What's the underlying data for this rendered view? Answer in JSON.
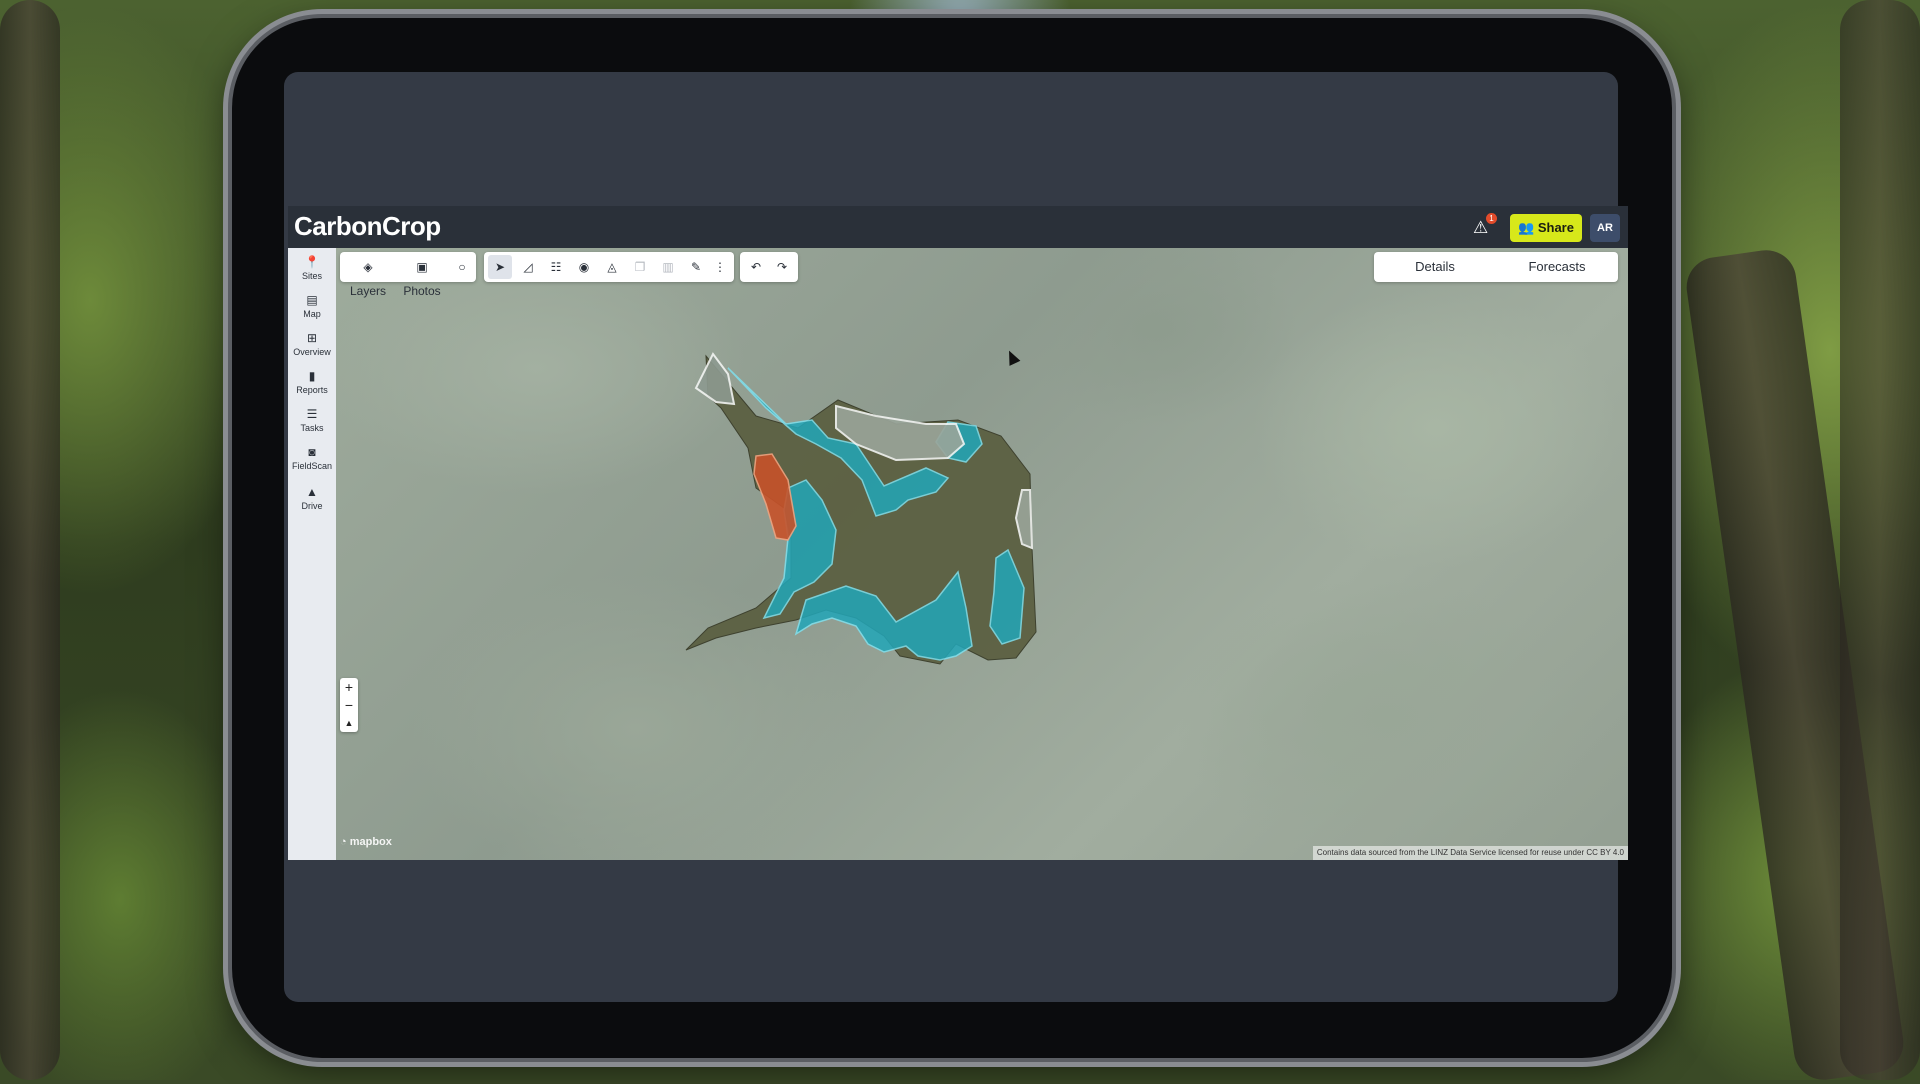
{
  "app": {
    "logo": "CarbonCrop",
    "alert_badge": "1",
    "share_label": "Share",
    "avatar_initials": "AR"
  },
  "sidebar": {
    "items": [
      {
        "label": "Sites",
        "icon": "map-pin-icon"
      },
      {
        "label": "Map",
        "icon": "map-icon"
      },
      {
        "label": "Overview",
        "icon": "grid-icon"
      },
      {
        "label": "Reports",
        "icon": "document-icon"
      },
      {
        "label": "Tasks",
        "icon": "list-icon"
      },
      {
        "label": "FieldScan",
        "icon": "camera-icon"
      },
      {
        "label": "Drive",
        "icon": "drive-icon"
      }
    ]
  },
  "toolbar": {
    "layers_label": "Layers",
    "photos_label": "Photos"
  },
  "tabs": [
    {
      "label": "Details"
    },
    {
      "label": "Forecasts"
    }
  ],
  "map": {
    "zoom_in": "+",
    "zoom_out": "−",
    "compass": "▲",
    "mapbox_label": "mapbox",
    "attribution": "Contains data sourced from the LINZ Data Service licensed for reuse under CC BY 4.0"
  },
  "colors": {
    "accent": "#d7e81a",
    "forest_fill": "#22a6b8",
    "highlight_fill": "#c7522a",
    "site_fill": "#5b5f3f"
  }
}
